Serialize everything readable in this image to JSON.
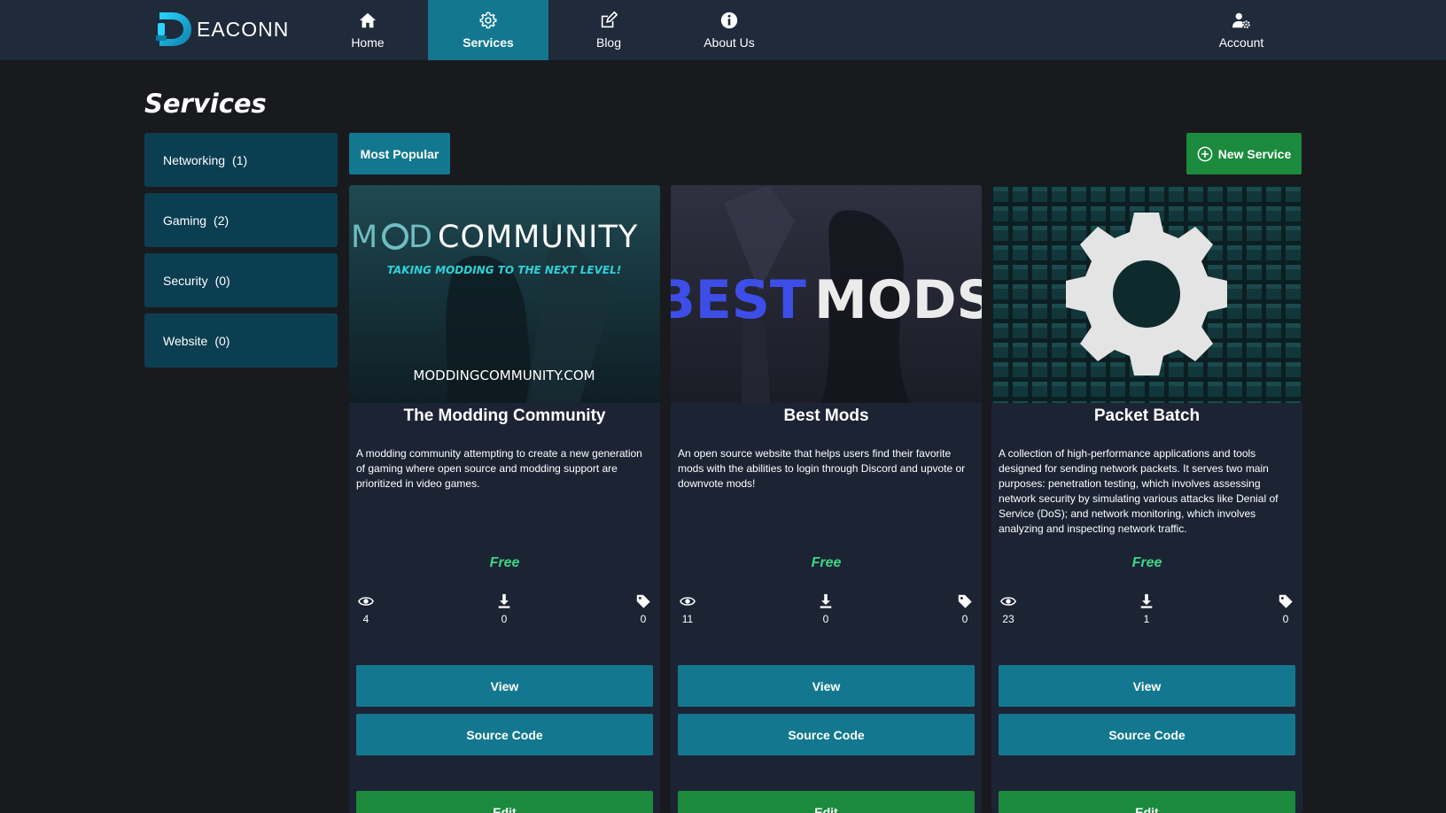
{
  "navbar": {
    "brand": "EACONN",
    "items": [
      {
        "label": "Home",
        "icon": "home-icon"
      },
      {
        "label": "Services",
        "icon": "gear-icon",
        "active": true
      },
      {
        "label": "Blog",
        "icon": "edit-icon"
      },
      {
        "label": "About Us",
        "icon": "info-icon"
      }
    ],
    "account": {
      "label": "Account",
      "icon": "user-cog-icon"
    }
  },
  "page": {
    "title": "Services"
  },
  "sidebar": {
    "items": [
      {
        "label": "Networking",
        "count": "(1)"
      },
      {
        "label": "Gaming",
        "count": "(2)"
      },
      {
        "label": "Security",
        "count": "(0)"
      },
      {
        "label": "Website",
        "count": "(0)"
      }
    ]
  },
  "toolbar": {
    "popular_label": "Most Popular",
    "new_label": "New Service"
  },
  "cards": [
    {
      "banner_text": {
        "title": "MODCOMMUNITY",
        "tagline": "TAKING MODDING TO THE NEXT LEVEL!",
        "url": "MODDINGCOMMUNITY.COM"
      },
      "title": "The Modding Community",
      "description": "A modding community attempting to create a new generation of gaming where open source and modding support are prioritized in video games.",
      "price": "Free",
      "views": "4",
      "downloads": "0",
      "tags": "0",
      "view_label": "View",
      "source_label": "Source Code",
      "edit_label": "Edit"
    },
    {
      "banner_text": {
        "word1": "BEST",
        "word2": "MODS"
      },
      "title": "Best Mods",
      "description": "An open source website that helps users find their favorite mods with the abilities to login through Discord and upvote or downvote mods!",
      "price": "Free",
      "views": "11",
      "downloads": "0",
      "tags": "0",
      "view_label": "View",
      "source_label": "Source Code",
      "edit_label": "Edit"
    },
    {
      "title": "Packet Batch",
      "description": "A collection of high-performance applications and tools designed for sending network packets. It serves two main purposes: penetration testing, which involves assessing network security by simulating various attacks like Denial of Service (DoS); and network monitoring, which involves analyzing and inspecting network traffic.",
      "price": "Free",
      "views": "23",
      "downloads": "1",
      "tags": "0",
      "view_label": "View",
      "source_label": "Source Code",
      "edit_label": "Edit"
    }
  ],
  "colors": {
    "navbar_bg": "#1f2a3a",
    "accent": "#13788f",
    "sidebar_bg": "#0c3e52",
    "success": "#1b8a3c",
    "price": "#3fd585",
    "card_bg": "#1c2434"
  }
}
